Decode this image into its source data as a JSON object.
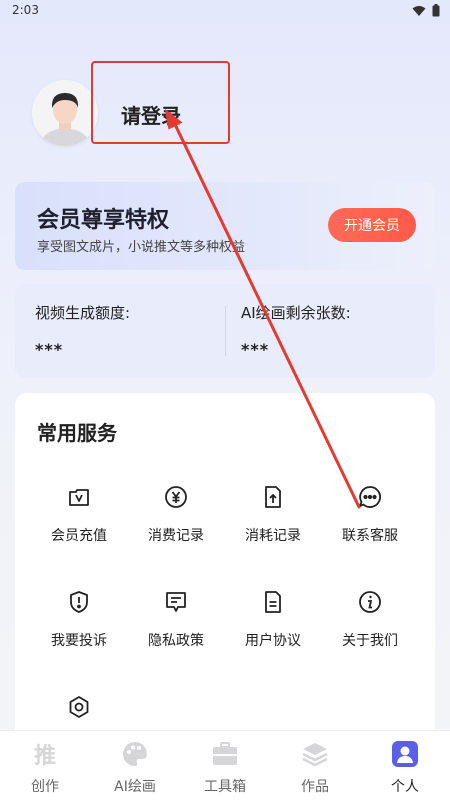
{
  "status_bar": {
    "time": "2:03"
  },
  "profile": {
    "login_text": "请登录"
  },
  "vip": {
    "title": "会员尊享特权",
    "subtitle": "享受图文成片，小说推文等多种权益",
    "button": "开通会员"
  },
  "quota": {
    "video_label": "视频生成额度:",
    "video_value": "***",
    "ai_label": "AI绘画剩余张数:",
    "ai_value": "***"
  },
  "services": {
    "title": "常用服务",
    "items": [
      {
        "label": "会员充值",
        "icon": "membership-recharge-icon"
      },
      {
        "label": "消费记录",
        "icon": "yen-coin-icon"
      },
      {
        "label": "消耗记录",
        "icon": "document-upload-icon"
      },
      {
        "label": "联系客服",
        "icon": "chat-bubble-icon"
      },
      {
        "label": "我要投诉",
        "icon": "shield-exclamation-icon"
      },
      {
        "label": "隐私政策",
        "icon": "message-lines-icon"
      },
      {
        "label": "用户协议",
        "icon": "document-lines-icon"
      },
      {
        "label": "关于我们",
        "icon": "info-icon"
      },
      {
        "label": "",
        "icon": "settings-hexagon-icon"
      }
    ]
  },
  "tabbar": {
    "tabs": [
      {
        "label": "创作",
        "icon": "push-character-icon"
      },
      {
        "label": "AI绘画",
        "icon": "palette-icon"
      },
      {
        "label": "工具箱",
        "icon": "toolbox-icon"
      },
      {
        "label": "作品",
        "icon": "layers-icon"
      },
      {
        "label": "个人",
        "icon": "person-icon",
        "active": true
      }
    ]
  },
  "colors": {
    "accent_red": "#e53a32",
    "vip_button": "#ff5a4a",
    "active_tab": "#5b5fe8"
  }
}
